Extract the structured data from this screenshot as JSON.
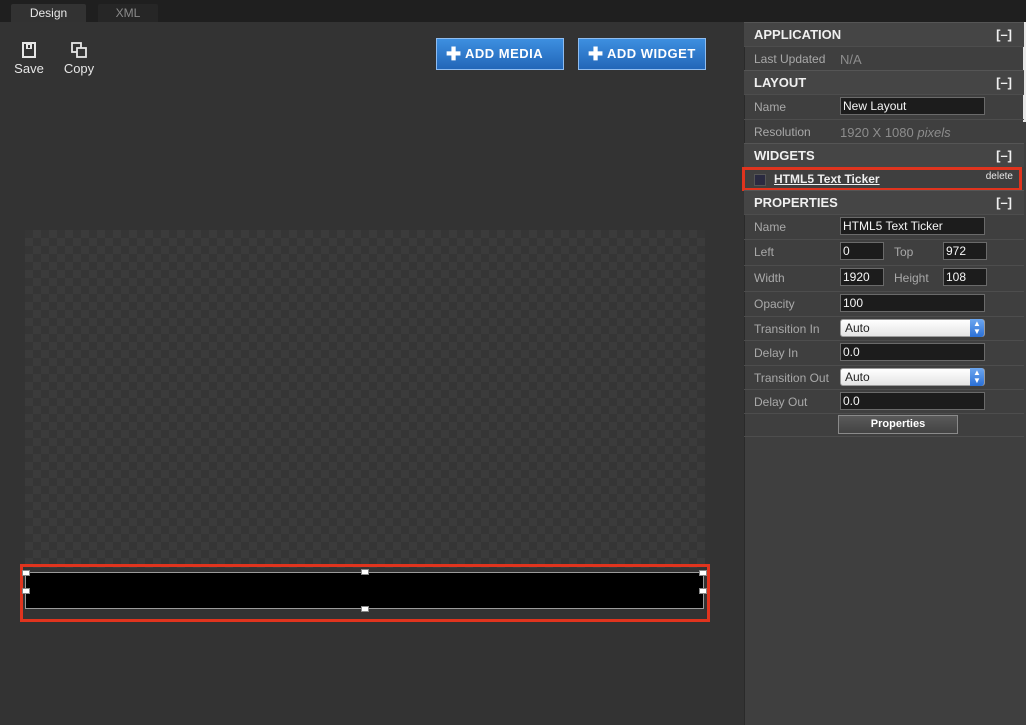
{
  "tabs": [
    {
      "label": "Design",
      "active": true
    },
    {
      "label": "XML",
      "active": false
    }
  ],
  "toolbar": {
    "save_label": "Save",
    "copy_label": "Copy",
    "add_media_label": "ADD MEDIA",
    "add_widget_label": "ADD WIDGET"
  },
  "application": {
    "title": "APPLICATION",
    "collapse": "[–]",
    "last_updated_label": "Last Updated",
    "last_updated_value": "N/A"
  },
  "layout": {
    "title": "LAYOUT",
    "collapse": "[–]",
    "name_label": "Name",
    "name_value": "New Layout",
    "resolution_label": "Resolution",
    "resolution_value": "1920 X 1080",
    "resolution_unit": "pixels"
  },
  "widgets": {
    "title": "WIDGETS",
    "collapse": "[–]",
    "items": [
      {
        "name": "HTML5 Text Ticker",
        "delete_label": "delete"
      }
    ]
  },
  "properties": {
    "title": "PROPERTIES",
    "collapse": "[–]",
    "name_label": "Name",
    "name_value": "HTML5 Text Ticker",
    "left_label": "Left",
    "left_value": "0",
    "top_label": "Top",
    "top_value": "972",
    "width_label": "Width",
    "width_value": "1920",
    "height_label": "Height",
    "height_value": "108",
    "opacity_label": "Opacity",
    "opacity_value": "100",
    "transition_in_label": "Transition In",
    "transition_in_value": "Auto",
    "delay_in_label": "Delay In",
    "delay_in_value": "0.0",
    "transition_out_label": "Transition Out",
    "transition_out_value": "Auto",
    "delay_out_label": "Delay Out",
    "delay_out_value": "0.0",
    "properties_button": "Properties"
  },
  "colors": {
    "accent_blue": "#2a76d2",
    "highlight_red": "#e0341e",
    "panel_bg": "#3f3f3f",
    "canvas_bg": "#333333"
  }
}
